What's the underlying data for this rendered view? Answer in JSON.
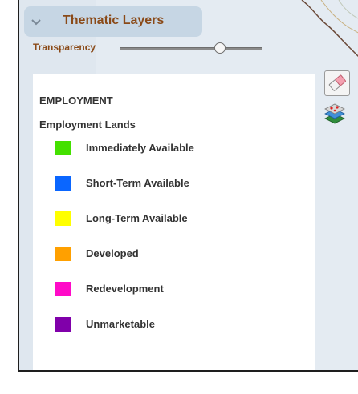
{
  "panel": {
    "title": "Thematic Layers",
    "transparency_label": "Transparency",
    "transparency_value_percent": 72
  },
  "legend": {
    "group_title": "EMPLOYMENT",
    "subgroup_title": "Employment Lands",
    "items": [
      {
        "label": "Immediately Available",
        "color": "#44e000"
      },
      {
        "label": "Short-Term Available",
        "color": "#0a66ff"
      },
      {
        "label": "Long-Term Available",
        "color": "#ffff00"
      },
      {
        "label": "Developed",
        "color": "#ffa000"
      },
      {
        "label": "Redevelopment",
        "color": "#ff0ac8"
      },
      {
        "label": "Unmarketable",
        "color": "#8000aa"
      }
    ]
  },
  "tools": {
    "eraser_icon": "eraser-icon",
    "layers_icon": "layers-icon"
  }
}
